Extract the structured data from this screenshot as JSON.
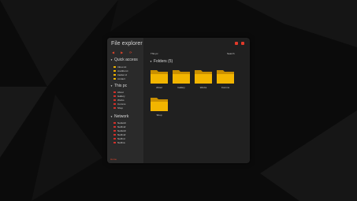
{
  "colors": {
    "accent": "#e0452b",
    "folder": "#f2b500",
    "drive": "#d9302a",
    "window_bg": "#202020",
    "sidebar_bg": "#2a2a2a"
  },
  "window": {
    "title": "File explorer"
  },
  "sidebar": {
    "toolbar_icons": [
      "back-icon",
      "forward-icon",
      "refresh-icon"
    ],
    "quick_access": {
      "label": "Quick access",
      "items": [
        "Inbox.txt",
        "crediits.txt",
        "tracker.cl",
        "contact"
      ]
    },
    "this_pc": {
      "label": "This pc",
      "items": [
        "About",
        "Gallery",
        "Works",
        "Comms",
        "Shop"
      ]
    },
    "network": {
      "label": "Network",
      "items": [
        "Netfetch",
        "Netfindr",
        "Netfetch",
        "Netfindr",
        "Netfind",
        "Netfina"
      ]
    },
    "footer_link": "Home"
  },
  "main": {
    "breadcrumb": "This pc",
    "search_label": "Search",
    "folders_header": "Folders (5)",
    "folders": [
      "About",
      "Gallery",
      "Works",
      "Comms",
      "Shop"
    ]
  }
}
